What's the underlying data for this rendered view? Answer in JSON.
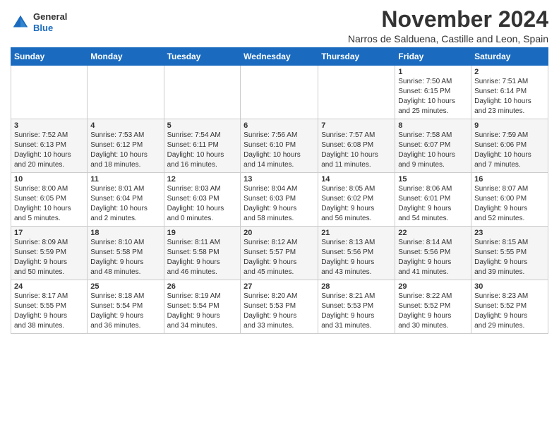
{
  "header": {
    "logo": {
      "general": "General",
      "blue": "Blue"
    },
    "month": "November 2024",
    "location": "Narros de Salduena, Castille and Leon, Spain"
  },
  "weekdays": [
    "Sunday",
    "Monday",
    "Tuesday",
    "Wednesday",
    "Thursday",
    "Friday",
    "Saturday"
  ],
  "weeks": [
    [
      {
        "day": "",
        "info": ""
      },
      {
        "day": "",
        "info": ""
      },
      {
        "day": "",
        "info": ""
      },
      {
        "day": "",
        "info": ""
      },
      {
        "day": "",
        "info": ""
      },
      {
        "day": "1",
        "info": "Sunrise: 7:50 AM\nSunset: 6:15 PM\nDaylight: 10 hours\nand 25 minutes."
      },
      {
        "day": "2",
        "info": "Sunrise: 7:51 AM\nSunset: 6:14 PM\nDaylight: 10 hours\nand 23 minutes."
      }
    ],
    [
      {
        "day": "3",
        "info": "Sunrise: 7:52 AM\nSunset: 6:13 PM\nDaylight: 10 hours\nand 20 minutes."
      },
      {
        "day": "4",
        "info": "Sunrise: 7:53 AM\nSunset: 6:12 PM\nDaylight: 10 hours\nand 18 minutes."
      },
      {
        "day": "5",
        "info": "Sunrise: 7:54 AM\nSunset: 6:11 PM\nDaylight: 10 hours\nand 16 minutes."
      },
      {
        "day": "6",
        "info": "Sunrise: 7:56 AM\nSunset: 6:10 PM\nDaylight: 10 hours\nand 14 minutes."
      },
      {
        "day": "7",
        "info": "Sunrise: 7:57 AM\nSunset: 6:08 PM\nDaylight: 10 hours\nand 11 minutes."
      },
      {
        "day": "8",
        "info": "Sunrise: 7:58 AM\nSunset: 6:07 PM\nDaylight: 10 hours\nand 9 minutes."
      },
      {
        "day": "9",
        "info": "Sunrise: 7:59 AM\nSunset: 6:06 PM\nDaylight: 10 hours\nand 7 minutes."
      }
    ],
    [
      {
        "day": "10",
        "info": "Sunrise: 8:00 AM\nSunset: 6:05 PM\nDaylight: 10 hours\nand 5 minutes."
      },
      {
        "day": "11",
        "info": "Sunrise: 8:01 AM\nSunset: 6:04 PM\nDaylight: 10 hours\nand 2 minutes."
      },
      {
        "day": "12",
        "info": "Sunrise: 8:03 AM\nSunset: 6:03 PM\nDaylight: 10 hours\nand 0 minutes."
      },
      {
        "day": "13",
        "info": "Sunrise: 8:04 AM\nSunset: 6:03 PM\nDaylight: 9 hours\nand 58 minutes."
      },
      {
        "day": "14",
        "info": "Sunrise: 8:05 AM\nSunset: 6:02 PM\nDaylight: 9 hours\nand 56 minutes."
      },
      {
        "day": "15",
        "info": "Sunrise: 8:06 AM\nSunset: 6:01 PM\nDaylight: 9 hours\nand 54 minutes."
      },
      {
        "day": "16",
        "info": "Sunrise: 8:07 AM\nSunset: 6:00 PM\nDaylight: 9 hours\nand 52 minutes."
      }
    ],
    [
      {
        "day": "17",
        "info": "Sunrise: 8:09 AM\nSunset: 5:59 PM\nDaylight: 9 hours\nand 50 minutes."
      },
      {
        "day": "18",
        "info": "Sunrise: 8:10 AM\nSunset: 5:58 PM\nDaylight: 9 hours\nand 48 minutes."
      },
      {
        "day": "19",
        "info": "Sunrise: 8:11 AM\nSunset: 5:58 PM\nDaylight: 9 hours\nand 46 minutes."
      },
      {
        "day": "20",
        "info": "Sunrise: 8:12 AM\nSunset: 5:57 PM\nDaylight: 9 hours\nand 45 minutes."
      },
      {
        "day": "21",
        "info": "Sunrise: 8:13 AM\nSunset: 5:56 PM\nDaylight: 9 hours\nand 43 minutes."
      },
      {
        "day": "22",
        "info": "Sunrise: 8:14 AM\nSunset: 5:56 PM\nDaylight: 9 hours\nand 41 minutes."
      },
      {
        "day": "23",
        "info": "Sunrise: 8:15 AM\nSunset: 5:55 PM\nDaylight: 9 hours\nand 39 minutes."
      }
    ],
    [
      {
        "day": "24",
        "info": "Sunrise: 8:17 AM\nSunset: 5:55 PM\nDaylight: 9 hours\nand 38 minutes."
      },
      {
        "day": "25",
        "info": "Sunrise: 8:18 AM\nSunset: 5:54 PM\nDaylight: 9 hours\nand 36 minutes."
      },
      {
        "day": "26",
        "info": "Sunrise: 8:19 AM\nSunset: 5:54 PM\nDaylight: 9 hours\nand 34 minutes."
      },
      {
        "day": "27",
        "info": "Sunrise: 8:20 AM\nSunset: 5:53 PM\nDaylight: 9 hours\nand 33 minutes."
      },
      {
        "day": "28",
        "info": "Sunrise: 8:21 AM\nSunset: 5:53 PM\nDaylight: 9 hours\nand 31 minutes."
      },
      {
        "day": "29",
        "info": "Sunrise: 8:22 AM\nSunset: 5:52 PM\nDaylight: 9 hours\nand 30 minutes."
      },
      {
        "day": "30",
        "info": "Sunrise: 8:23 AM\nSunset: 5:52 PM\nDaylight: 9 hours\nand 29 minutes."
      }
    ]
  ]
}
